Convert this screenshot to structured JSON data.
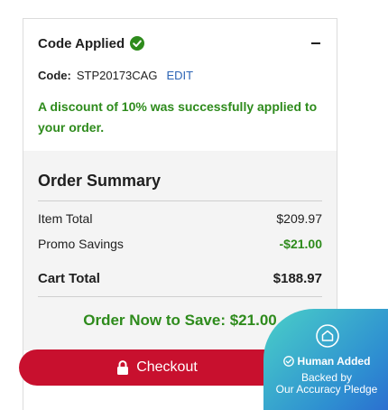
{
  "promo": {
    "title": "Code Applied",
    "code_label": "Code:",
    "code_value": "STP20173CAG",
    "edit_label": "EDIT",
    "message": "A discount of 10% was successfully applied to your order."
  },
  "summary": {
    "title": "Order Summary",
    "rows": [
      {
        "label": "Item Total",
        "value": "$209.97"
      },
      {
        "label": "Promo Savings",
        "value": "-$21.00"
      },
      {
        "label": "Cart Total",
        "value": "$188.97"
      }
    ],
    "save_banner": "Order Now to Save: $21.00"
  },
  "checkout": {
    "label": "Checkout"
  },
  "badge": {
    "title": "Human Added",
    "line1": "Backed by",
    "line2": "Our Accuracy Pledge"
  },
  "colors": {
    "accent_green": "#2e8b1c",
    "checkout_red": "#c8102e",
    "link_blue": "#2b63b5"
  },
  "icons": [
    "check-circle-icon",
    "minus-icon",
    "lock-icon",
    "house-outline-icon",
    "check-circle-outline-icon"
  ]
}
